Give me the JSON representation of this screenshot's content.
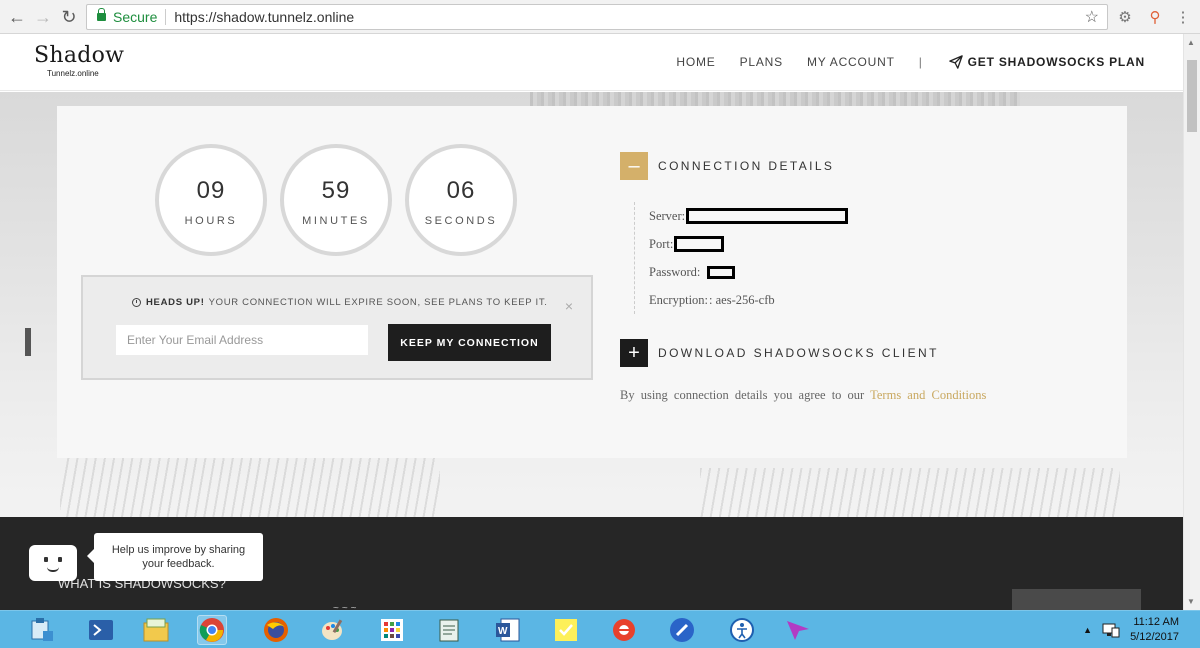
{
  "browser": {
    "secure_label": "Secure",
    "url": "https://shadow.tunnelz.online",
    "back_icon": "back-arrow-icon",
    "forward_icon": "forward-arrow-icon",
    "reload_icon": "reload-icon",
    "star_icon": "star-icon"
  },
  "site": {
    "logo_main": "Shadow",
    "logo_sub": "Tunnelz.online",
    "nav": [
      "HOME",
      "PLANS",
      "MY ACCOUNT"
    ],
    "nav_divider": "|",
    "cta_label": "GET SHADOWSOCKS PLAN"
  },
  "timer": [
    {
      "value": "09",
      "label": "HOURS"
    },
    {
      "value": "59",
      "label": "MINUTES"
    },
    {
      "value": "06",
      "label": "SECONDS"
    }
  ],
  "alert": {
    "lead": "HEADS UP!",
    "message": "YOUR CONNECTION WILL EXPIRE SOON, SEE PLANS TO KEEP IT.",
    "close": "×",
    "email_placeholder": "Enter Your Email Address",
    "button_label": "KEEP MY CONNECTION"
  },
  "connection": {
    "toggle_symbol": "–",
    "title": "CONNECTION DETAILS",
    "server_label": "Server:",
    "port_label": "Port:",
    "password_label": "Password:",
    "encryption_label": "Encryption:",
    "encryption_value": ": aes-256-cfb"
  },
  "download": {
    "toggle_symbol": "+",
    "title": "DOWNLOAD SHADOWSOCKS CLIENT"
  },
  "consent": {
    "text": "By using connection details you agree to our",
    "link": "Terms and Conditions"
  },
  "dark_section": {
    "heading": "WHAT IS SHADOWSOCKS?",
    "deco": "~~~"
  },
  "feedback": {
    "line1": "Help us improve by sharing",
    "line2": "your feedback."
  },
  "taskbar": {
    "time": "11:12 AM",
    "date": "5/12/2017"
  },
  "colors": {
    "accent_gold": "#d4b06a",
    "link_gold": "#c9a85f",
    "button_dark": "#1e1e1e",
    "taskbar_blue": "#5bb6e4",
    "secure_green": "#1e8e3e"
  }
}
